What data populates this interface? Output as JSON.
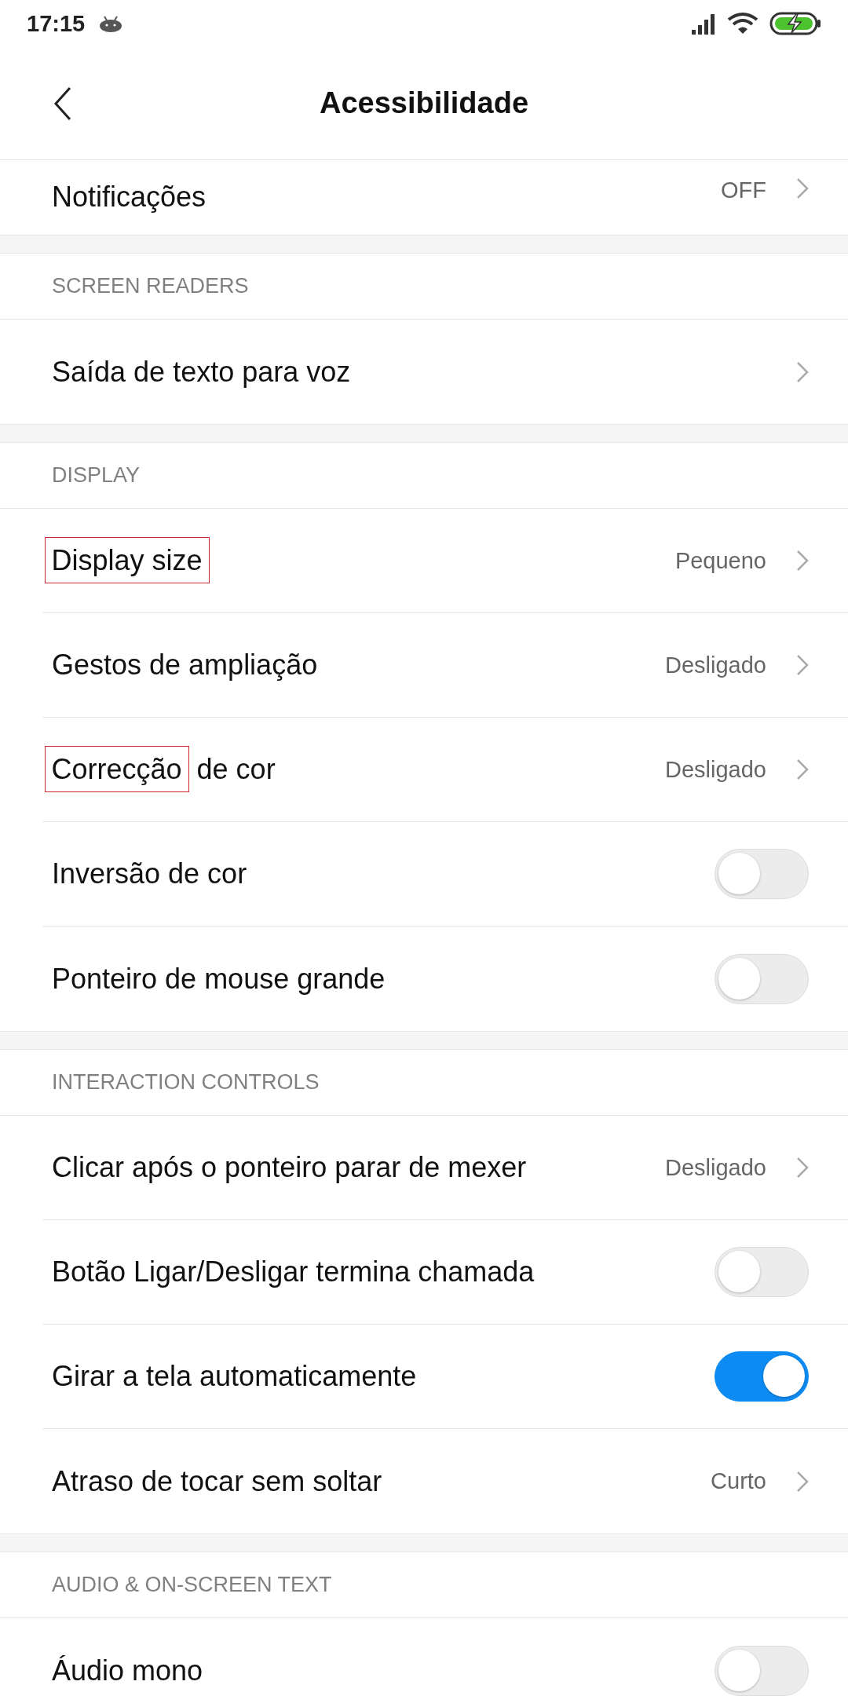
{
  "status_bar": {
    "time": "17:15"
  },
  "header": {
    "title": "Acessibilidade"
  },
  "sections": [
    {
      "rows": [
        {
          "kind": "link",
          "title": [
            {
              "text": "Notificações",
              "boxed": false
            }
          ],
          "value": "OFF"
        }
      ]
    },
    {
      "heading": "SCREEN READERS",
      "rows": [
        {
          "kind": "link",
          "title": [
            {
              "text": "Saída de texto para voz",
              "boxed": false
            }
          ]
        }
      ]
    },
    {
      "heading": "DISPLAY",
      "rows": [
        {
          "kind": "link",
          "title": [
            {
              "text": "Display size",
              "boxed": true
            }
          ],
          "value": "Pequeno"
        },
        {
          "kind": "link",
          "title": [
            {
              "text": "Gestos de ampliação",
              "boxed": false
            }
          ],
          "value": "Desligado"
        },
        {
          "kind": "link",
          "title": [
            {
              "text": "Correcção",
              "boxed": true
            },
            {
              "text": " de cor",
              "boxed": false
            }
          ],
          "value": "Desligado"
        },
        {
          "kind": "toggle",
          "title": [
            {
              "text": "Inversão de cor",
              "boxed": false
            }
          ],
          "on": false
        },
        {
          "kind": "toggle",
          "title": [
            {
              "text": "Ponteiro de mouse grande",
              "boxed": false
            }
          ],
          "on": false
        }
      ]
    },
    {
      "heading": "INTERACTION CONTROLS",
      "rows": [
        {
          "kind": "link",
          "title": [
            {
              "text": "Clicar após o ponteiro parar de mexer",
              "boxed": false
            }
          ],
          "value": "Desligado"
        },
        {
          "kind": "toggle",
          "title": [
            {
              "text": "Botão Ligar/Desligar termina chamada",
              "boxed": false
            }
          ],
          "on": false
        },
        {
          "kind": "toggle",
          "title": [
            {
              "text": "Girar a tela automaticamente",
              "boxed": false
            }
          ],
          "on": true
        },
        {
          "kind": "link",
          "title": [
            {
              "text": "Atraso de tocar sem soltar",
              "boxed": false
            }
          ],
          "value": "Curto"
        }
      ]
    },
    {
      "heading": "AUDIO & ON-SCREEN TEXT",
      "rows": [
        {
          "kind": "toggle",
          "title": [
            {
              "text": "Áudio mono",
              "boxed": false
            }
          ],
          "on": false
        }
      ]
    }
  ]
}
